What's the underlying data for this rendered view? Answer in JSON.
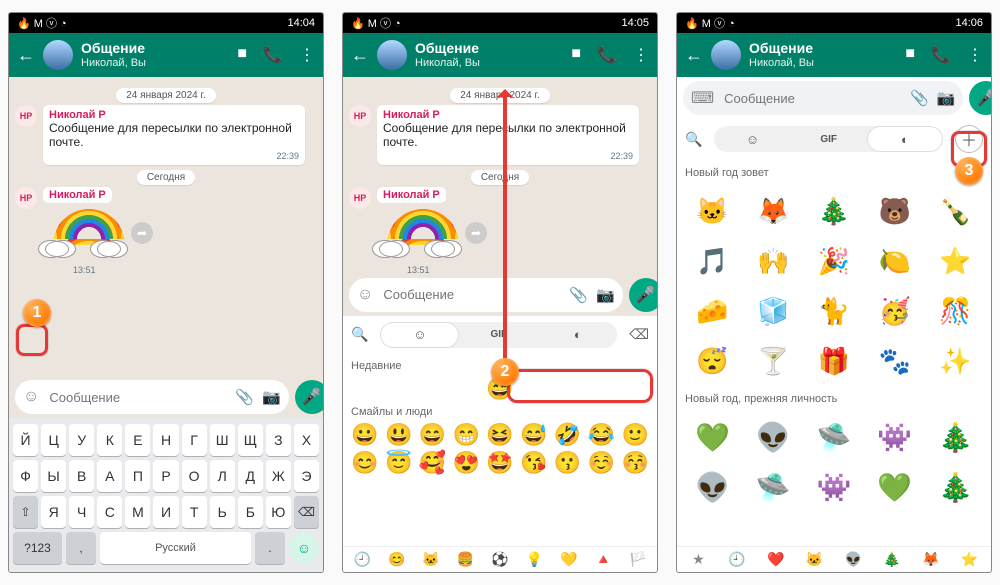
{
  "status": {
    "icons": "🔥 M ⓥ ◔",
    "t1": "14:04",
    "t2": "14:05",
    "t3": "14:06"
  },
  "header": {
    "title": "Общение",
    "subtitle": "Николай, Вы"
  },
  "date": "24 января 2024 г.",
  "sender": {
    "initials": "НР",
    "name": "Николай Р"
  },
  "msg": {
    "text": "Сообщение для пересылки по электронной почте.",
    "time": "22:39"
  },
  "today": "Сегодня",
  "stickerTime": "13:51",
  "input": {
    "placeholder": "Сообщение"
  },
  "kbd": {
    "r1": [
      "Й",
      "Ц",
      "У",
      "К",
      "Е",
      "Н",
      "Г",
      "Ш",
      "Щ",
      "З",
      "Х"
    ],
    "r2": [
      "Ф",
      "Ы",
      "В",
      "А",
      "П",
      "Р",
      "О",
      "Л",
      "Д",
      "Ж",
      "Э"
    ],
    "r3_shift": "⇧",
    "r3": [
      "Я",
      "Ч",
      "С",
      "М",
      "И",
      "Т",
      "Ь",
      "Б",
      "Ю"
    ],
    "r3_bsp": "⌫",
    "num": "?123",
    "comma": ",",
    "space": "Русский",
    "dot": ".",
    "enter": "↵"
  },
  "emoji": {
    "recent": "Недавние",
    "recentRow": [
      "😄"
    ],
    "cat": "Смайлы и люди",
    "rows": [
      [
        "😀",
        "😃",
        "😄",
        "😁",
        "😆",
        "😅",
        "🤣",
        "😂",
        "🙂"
      ],
      [
        "😊",
        "😇",
        "🥰",
        "😍",
        "🤩",
        "😘",
        "😗",
        "☺️",
        "😚"
      ]
    ],
    "bottom": [
      "🕘",
      "😊",
      "🐱",
      "🍔",
      "⚽",
      "💡",
      "💛",
      "🔺",
      "🏳️"
    ]
  },
  "stickers": {
    "pack1": "Новый год зовет",
    "grid1": [
      "🐱",
      "🦊",
      "🎄",
      "🐻",
      "🍾",
      "🎵",
      "🙌",
      "🎉",
      "🍋",
      "⭐",
      "🧀",
      "🧊",
      "🐈",
      "🥳",
      "🎊",
      "😴",
      "🍸",
      "🎁",
      "🐾",
      "✨"
    ],
    "pack2": "Новый год, прежняя личность",
    "grid2": [
      "💚",
      "👽",
      "🛸",
      "👾",
      "🎄",
      "👽",
      "🛸",
      "👾",
      "💚",
      "🎄"
    ]
  },
  "badges": {
    "b1": "1",
    "b2": "2",
    "b3": "3"
  }
}
